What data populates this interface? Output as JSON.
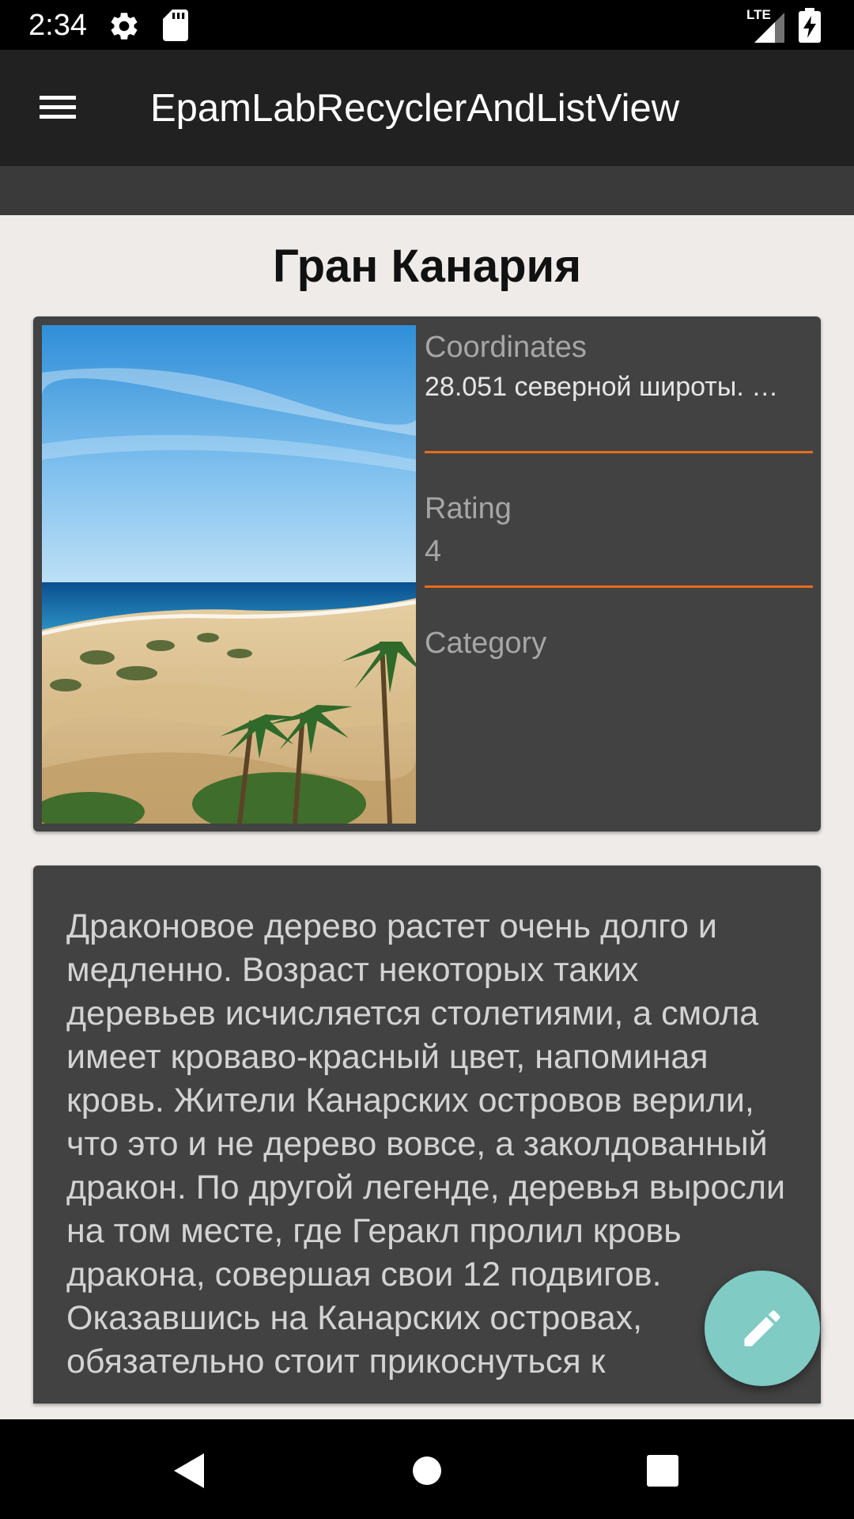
{
  "status_bar": {
    "time": "2:34",
    "network_label": "LTE",
    "icons": [
      "gear-icon",
      "sd-card-icon",
      "signal-icon",
      "battery-charging-icon"
    ]
  },
  "toolbar": {
    "title": "EpamLabRecyclerAndListView",
    "menu_icon": "menu-icon"
  },
  "page": {
    "title": "Гран Канария"
  },
  "info_card": {
    "photo_icon": "beach-photo",
    "coordinates_label": "Coordinates",
    "coordinates_value": "28.051 северной широты. …",
    "rating_label": "Rating",
    "rating_value": "4",
    "category_label": "Category",
    "category_value": ""
  },
  "description": {
    "text": "Драконовое дерево растет очень долго и медленно. Возраст некоторых таких деревьев исчисляется столетиями, а смола имеет кроваво-красный цвет, напоминая кровь. Жители Канарских островов верили, что это и не дерево вовсе, а заколдованный дракон. По другой легенде, деревья выросли на том месте, где Геракл пролил кровь дракона, совершая свои 12 подвигов. Оказавшись на Канарских островах, обязательно стоит прикоснуться к"
  },
  "fab": {
    "icon": "edit-pencil-icon",
    "color": "#80cbc4"
  },
  "colors": {
    "toolbar": "#212121",
    "card": "#424242",
    "accent": "#e86c1a",
    "background": "#efebe9"
  },
  "nav_bar": {
    "icons": [
      "back-icon",
      "home-icon",
      "recents-icon"
    ]
  }
}
